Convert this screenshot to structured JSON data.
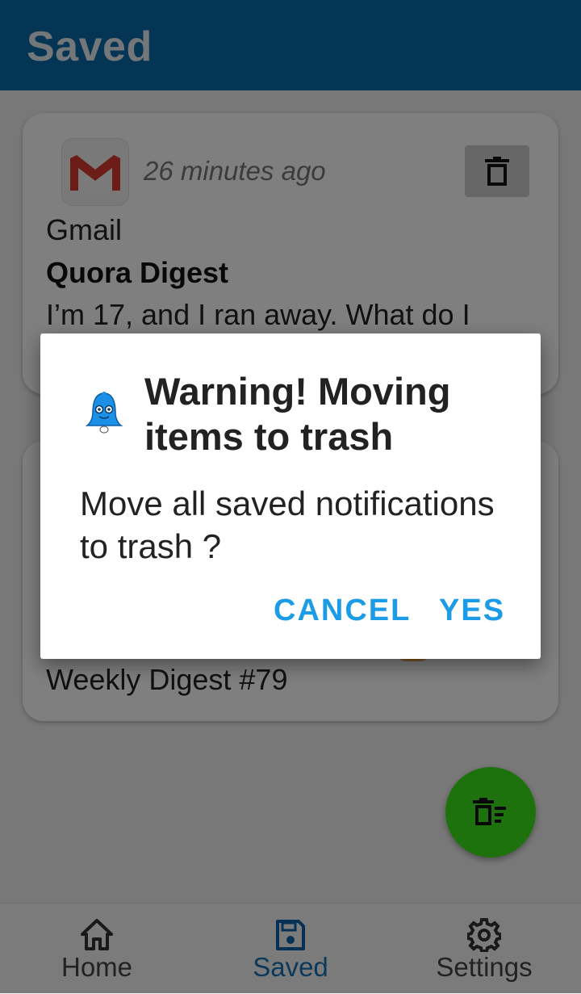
{
  "appbar": {
    "title": "Saved"
  },
  "cards": [
    {
      "app_name": "Gmail",
      "time": "26 minutes ago",
      "subject": "Quora Digest",
      "body": "I’m 17, and I ran away. What do I"
    },
    {
      "body": "Weekly Digest #79"
    }
  ],
  "dialog": {
    "title": "Warning! Moving items to trash",
    "message": "Move all saved notifications to trash ?",
    "cancel_label": "CANCEL",
    "yes_label": "YES"
  },
  "bottom_nav": {
    "items": [
      {
        "label": "Home",
        "icon": "home-icon"
      },
      {
        "label": "Saved",
        "icon": "save-icon"
      },
      {
        "label": "Settings",
        "icon": "gear-icon"
      }
    ],
    "active": "Saved"
  },
  "colors": {
    "appbar": "#0a6aa8",
    "accent": "#1c9ce6",
    "fab": "#3be51a",
    "active_nav": "#1572b8"
  }
}
